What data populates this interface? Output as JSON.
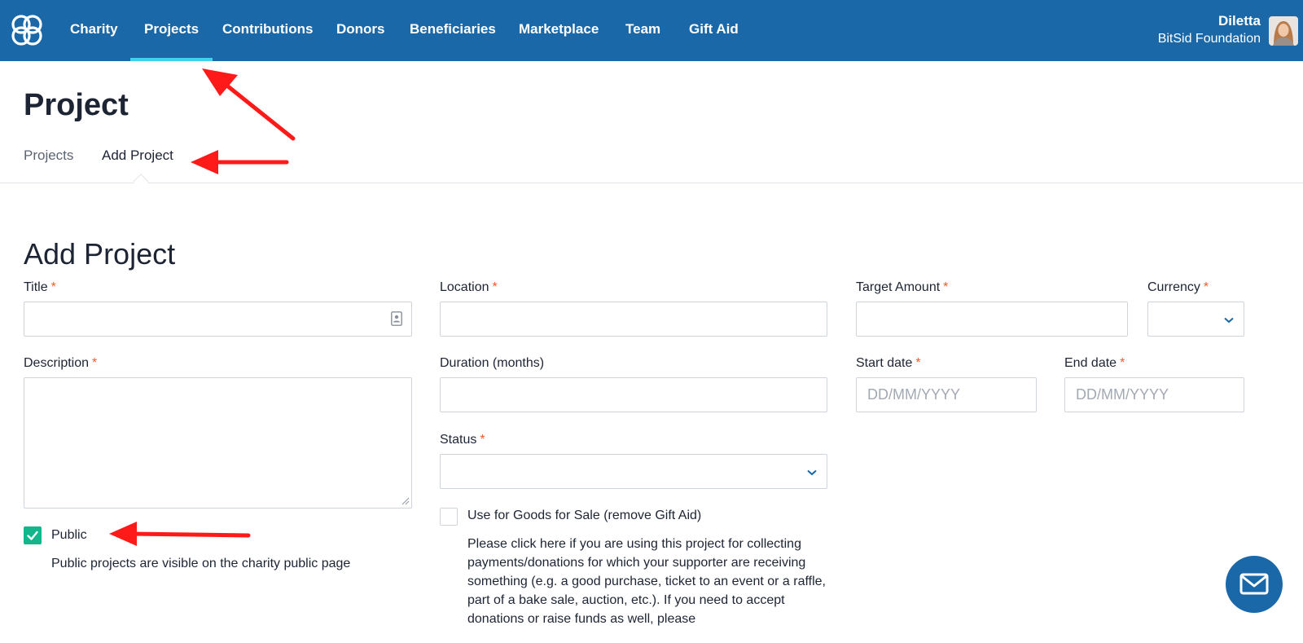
{
  "brand": {
    "accent": "#1a68a8",
    "active_underline": "#3fd0ea",
    "required": "#f15a2b",
    "check": "#12b68a",
    "annotation": "#ff1a1a"
  },
  "nav": {
    "items": [
      {
        "label": "Charity"
      },
      {
        "label": "Projects",
        "active": true
      },
      {
        "label": "Contributions"
      },
      {
        "label": "Donors"
      },
      {
        "label": "Beneficiaries"
      },
      {
        "label": "Marketplace"
      },
      {
        "label": "Team"
      },
      {
        "label": "Gift Aid"
      }
    ],
    "user": {
      "name": "Diletta",
      "org": "BitSid Foundation"
    }
  },
  "page": {
    "title": "Project",
    "subnav": {
      "projects": "Projects",
      "add_project": "Add Project"
    },
    "section_title": "Add Project"
  },
  "form": {
    "title": {
      "label": "Title",
      "value": ""
    },
    "location": {
      "label": "Location",
      "value": ""
    },
    "target_amount": {
      "label": "Target Amount",
      "value": ""
    },
    "currency": {
      "label": "Currency",
      "value": ""
    },
    "description": {
      "label": "Description",
      "value": ""
    },
    "duration": {
      "label": "Duration (months)",
      "value": ""
    },
    "start_date": {
      "label": "Start date",
      "placeholder": "DD/MM/YYYY"
    },
    "end_date": {
      "label": "End date",
      "placeholder": "DD/MM/YYYY"
    },
    "status": {
      "label": "Status",
      "value": ""
    },
    "required_mark": "*",
    "public": {
      "label": "Public",
      "checked": true,
      "help": "Public projects are visible on the charity public page"
    },
    "goods": {
      "label": "Use for Goods for Sale (remove Gift Aid)",
      "checked": false,
      "help": "Please click here if you are using this project for collecting payments/donations for which your supporter are receiving something (e.g. a good purchase, ticket to an event or a raffle, part of a bake sale, auction, etc.). If you need to accept donations or raise funds as well, please"
    }
  },
  "icons": {
    "logo": "charity-logo-icon",
    "contact": "id-card-icon",
    "chevron": "chevron-down-icon",
    "check": "check-icon",
    "mail": "mail-icon"
  }
}
